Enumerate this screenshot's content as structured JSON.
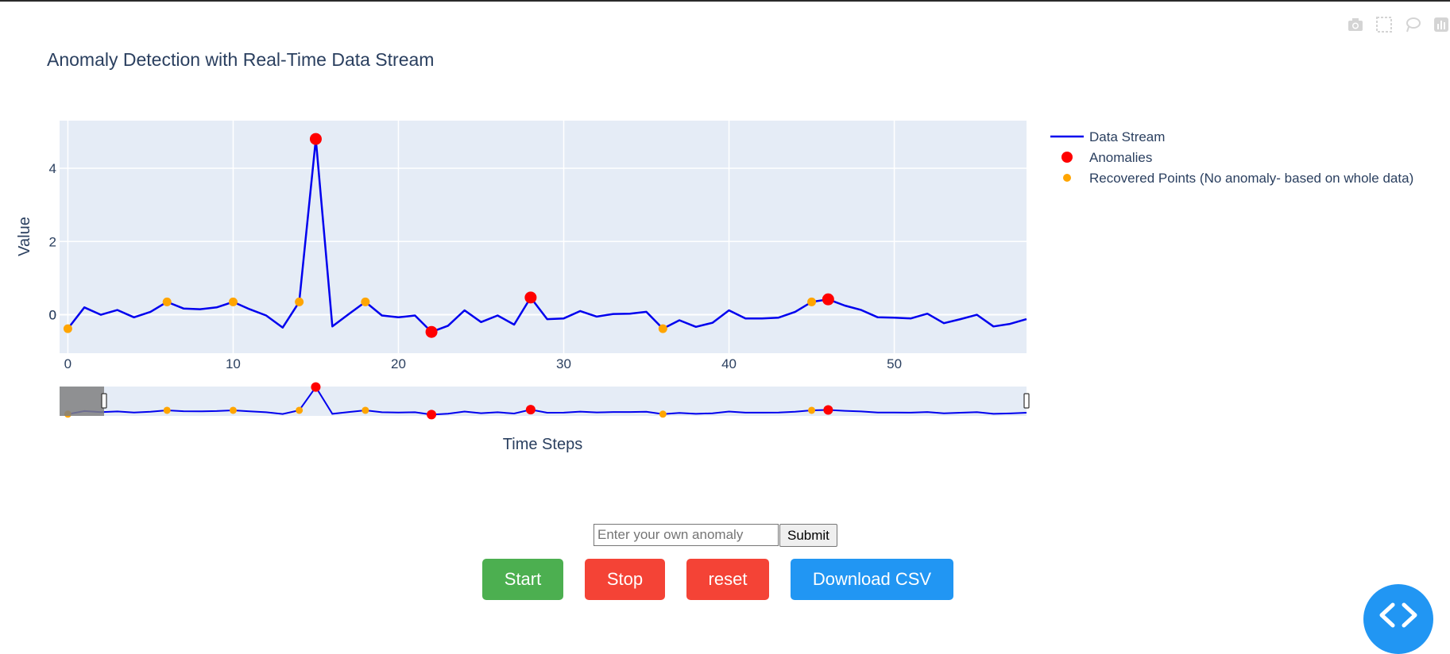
{
  "chart_data": {
    "type": "line",
    "title": "Anomaly Detection with Real-Time Data Stream",
    "xlabel": "Time Steps",
    "ylabel": "Value",
    "xlim": [
      -0.5,
      58
    ],
    "ylim": [
      -1.05,
      5.3
    ],
    "xticks": [
      0,
      10,
      20,
      30,
      40,
      50
    ],
    "yticks": [
      0,
      2,
      4
    ],
    "grid": true,
    "legend_position": "right",
    "series": [
      {
        "name": "Data Stream",
        "mode": "lines",
        "color": "#0000ee",
        "x": [
          0,
          1,
          2,
          3,
          4,
          5,
          6,
          7,
          8,
          9,
          10,
          11,
          12,
          13,
          14,
          15,
          16,
          17,
          18,
          19,
          20,
          21,
          22,
          23,
          24,
          25,
          26,
          27,
          28,
          29,
          30,
          31,
          32,
          33,
          34,
          35,
          36,
          37,
          38,
          39,
          40,
          41,
          42,
          43,
          44,
          45,
          46,
          47,
          48,
          49,
          50,
          51,
          52,
          53,
          54,
          55,
          56,
          57,
          58
        ],
        "y": [
          -0.38,
          0.2,
          0.0,
          0.13,
          -0.07,
          0.08,
          0.35,
          0.17,
          0.15,
          0.2,
          0.35,
          0.15,
          -0.02,
          -0.35,
          0.35,
          4.8,
          -0.32,
          0.02,
          0.35,
          -0.02,
          -0.07,
          -0.02,
          -0.47,
          -0.3,
          0.12,
          -0.2,
          -0.02,
          -0.27,
          0.47,
          -0.12,
          -0.1,
          0.1,
          -0.05,
          0.02,
          0.03,
          0.08,
          -0.38,
          -0.15,
          -0.33,
          -0.22,
          0.12,
          -0.1,
          -0.1,
          -0.08,
          0.08,
          0.35,
          0.42,
          0.25,
          0.13,
          -0.07,
          -0.08,
          -0.1,
          0.03,
          -0.23,
          -0.12,
          0.0,
          -0.32,
          -0.25,
          -0.12
        ]
      },
      {
        "name": "Anomalies",
        "mode": "markers",
        "color": "#ff0000",
        "x": [
          15,
          22,
          28,
          46
        ],
        "y": [
          4.8,
          -0.47,
          0.47,
          0.42
        ]
      },
      {
        "name": "Recovered Points (No anomaly- based on whole data)",
        "mode": "markers",
        "color": "#ffa500",
        "x": [
          0,
          6,
          10,
          14,
          18,
          36,
          45
        ],
        "y": [
          -0.38,
          0.35,
          0.35,
          0.35,
          0.35,
          -0.38,
          0.35
        ]
      }
    ]
  },
  "controls": {
    "input_placeholder": "Enter your own anomaly",
    "submit_label": "Submit",
    "start_label": "Start",
    "stop_label": "Stop",
    "reset_label": "reset",
    "download_label": "Download CSV"
  },
  "colors": {
    "plot_bg": "#e5ecf6",
    "start": "#4caf50",
    "stop": "#f44336",
    "download": "#2196f3"
  },
  "icons": [
    "camera-icon",
    "box-select-icon",
    "lasso-icon",
    "plotly-logo-icon",
    "code-icon"
  ]
}
